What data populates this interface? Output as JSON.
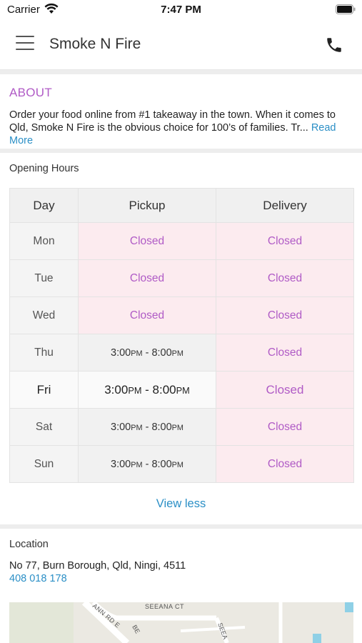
{
  "status_bar": {
    "carrier": "Carrier",
    "time": "7:47 PM"
  },
  "header": {
    "title": "Smoke N Fire",
    "menu_icon": "hamburger-menu-icon",
    "phone_icon": "phone-icon"
  },
  "about": {
    "title": "ABOUT",
    "text": "Order your food online from #1 takeaway in the town. When it comes to Qld, Smoke N Fire is the obvious choice for 100’s of families. Tr...",
    "read_more": "Read More"
  },
  "opening_hours": {
    "label": "Opening Hours",
    "columns": [
      "Day",
      "Pickup",
      "Delivery"
    ],
    "rows": [
      {
        "day": "Mon",
        "pickup": "Closed",
        "delivery": "Closed"
      },
      {
        "day": "Tue",
        "pickup": "Closed",
        "delivery": "Closed"
      },
      {
        "day": "Wed",
        "pickup": "Closed",
        "delivery": "Closed"
      },
      {
        "day": "Thu",
        "pickup": {
          "from": "3:00",
          "from_ampm": "PM",
          "sep": " - ",
          "to": "8:00",
          "to_ampm": "PM"
        },
        "delivery": "Closed"
      },
      {
        "day": "Fri",
        "pickup": {
          "from": "3:00",
          "from_ampm": "PM",
          "sep": " - ",
          "to": "8:00",
          "to_ampm": "PM"
        },
        "delivery": "Closed",
        "highlighted": true
      },
      {
        "day": "Sat",
        "pickup": {
          "from": "3:00",
          "from_ampm": "PM",
          "sep": " - ",
          "to": "8:00",
          "to_ampm": "PM"
        },
        "delivery": "Closed"
      },
      {
        "day": "Sun",
        "pickup": {
          "from": "3:00",
          "from_ampm": "PM",
          "sep": " - ",
          "to": "8:00",
          "to_ampm": "PM"
        },
        "delivery": "Closed"
      }
    ],
    "view_less": "View less"
  },
  "location": {
    "label": "Location",
    "address": "No 77, Burn Borough, Qld, Ningi, 4511",
    "phone": "408 018 178",
    "map_labels": [
      "SEEANA CT",
      "ANN RD E",
      "BE",
      "SEEA"
    ]
  },
  "colors": {
    "accent_purple": "#b05bc6",
    "link_blue": "#2b8fc6",
    "closed_bg": "#fcebef"
  }
}
